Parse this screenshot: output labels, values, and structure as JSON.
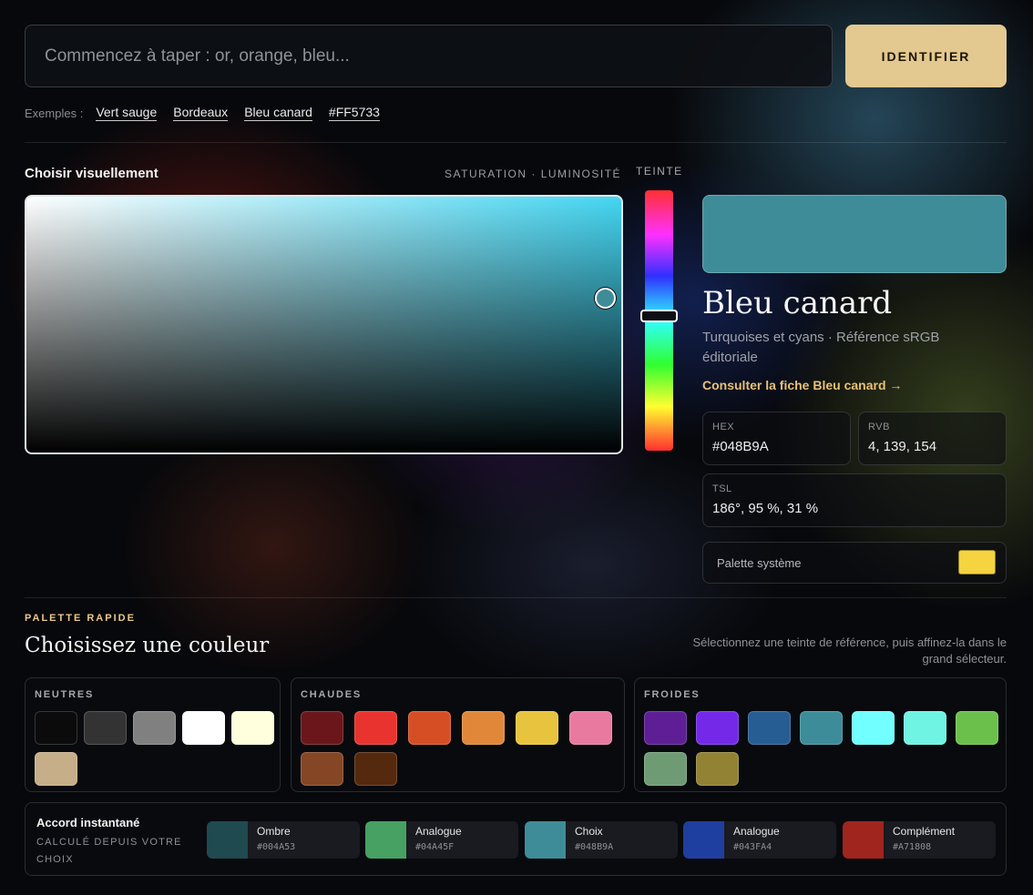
{
  "search": {
    "placeholder": "Commencez à taper : or, orange, bleu...",
    "button_label": "IDENTIFIER"
  },
  "examples": {
    "label": "Exemples :",
    "items": [
      "Vert sauge",
      "Bordeaux",
      "Bleu canard",
      "#FF5733"
    ]
  },
  "picker": {
    "title": "Choisir visuellement",
    "sv_caption": "SATURATION · LUMINOSITÉ",
    "hue_caption": "TEINTE",
    "selected_color": "#3F8C99"
  },
  "result": {
    "name": "Bleu canard",
    "subtitle": "Turquoises et cyans · Référence sRGB éditoriale",
    "link": "Consulter la fiche Bleu canard →",
    "hex_label": "HEX",
    "hex_value": "#048B9A",
    "rgb_label": "RVB",
    "rgb_value": "4, 139, 154",
    "hsl_label": "TSL",
    "hsl_value": "186°, 95 %, 31 %",
    "system_palette_label": "Palette système",
    "system_palette_color": "#F5D440"
  },
  "palette": {
    "kicker": "PALETTE RAPIDE",
    "title": "Choisissez une couleur",
    "help": "Sélectionnez une teinte de référence, puis affinez-la dans le grand sélecteur.",
    "groups": [
      {
        "label": "NEUTRES",
        "colors": [
          "#0B0B0B",
          "#333333",
          "#808080",
          "#FFFFFF",
          "#FFFFDD",
          "#C6AE88"
        ]
      },
      {
        "label": "CHAUDES",
        "colors": [
          "#6B161B",
          "#E8332E",
          "#D64F24",
          "#E0873A",
          "#E7C33E",
          "#E87AA0",
          "#844625",
          "#54290D"
        ]
      },
      {
        "label": "FROIDES",
        "colors": [
          "#5D1E96",
          "#7329E7",
          "#265D93",
          "#3C8C99",
          "#72FFFF",
          "#6FF3E3",
          "#6BC04B",
          "#6F9B74",
          "#928234"
        ]
      }
    ]
  },
  "harmony": {
    "title": "Accord instantané",
    "subtitle": "CALCULÉ DEPUIS VOTRE CHOIX",
    "items": [
      {
        "name": "Ombre",
        "hex": "#004A53",
        "swatch": "#1F4A50"
      },
      {
        "name": "Analogue",
        "hex": "#04A45F",
        "swatch": "#46A163"
      },
      {
        "name": "Choix",
        "hex": "#048B9A",
        "swatch": "#3F8C99"
      },
      {
        "name": "Analogue",
        "hex": "#043FA4",
        "swatch": "#1F3FA0"
      },
      {
        "name": "Complément",
        "hex": "#A71808",
        "swatch": "#A0251E"
      }
    ]
  }
}
